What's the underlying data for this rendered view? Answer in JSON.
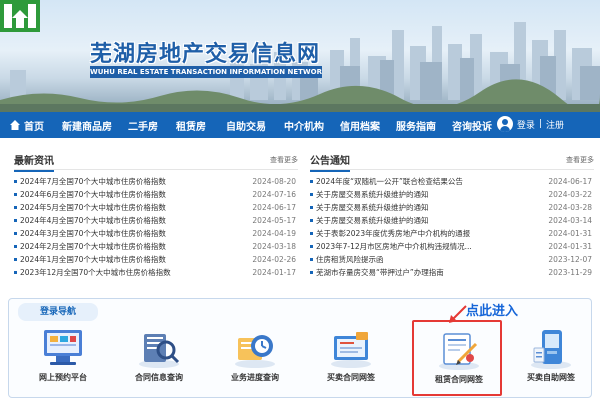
{
  "site": {
    "title": "芜湖房地产交易信息网",
    "subtitle": "WUHU REAL ESTATE TRANSACTION INFORMATION NETWORK"
  },
  "nav": {
    "items": [
      "首页",
      "新建商品房",
      "二手房",
      "租赁房",
      "自助交易",
      "中介机构",
      "信用档案",
      "服务指南",
      "咨询投诉"
    ],
    "login": "登录",
    "register": "注册",
    "separator": "|"
  },
  "news": {
    "title": "最新资讯",
    "more": "查看更多",
    "items": [
      {
        "text": "2024年7月全国70个大中城市住房价格指数",
        "date": "2024-08-20"
      },
      {
        "text": "2024年6月全国70个大中城市住房价格指数",
        "date": "2024-07-16"
      },
      {
        "text": "2024年5月全国70个大中城市住房价格指数",
        "date": "2024-06-17"
      },
      {
        "text": "2024年4月全国70个大中城市住房价格指数",
        "date": "2024-05-17"
      },
      {
        "text": "2024年3月全国70个大中城市住房价格指数",
        "date": "2024-04-19"
      },
      {
        "text": "2024年2月全国70个大中城市住房价格指数",
        "date": "2024-03-18"
      },
      {
        "text": "2024年1月全国70个大中城市住房价格指数",
        "date": "2024-02-26"
      },
      {
        "text": "2023年12月全国70个大中城市住房价格指数",
        "date": "2024-01-17"
      }
    ]
  },
  "notices": {
    "title": "公告通知",
    "more": "查看更多",
    "items": [
      {
        "text": "2024年度“双随机一公开”联合检查结果公告",
        "date": "2024-06-17"
      },
      {
        "text": "关于房屋交易系统升级维护的通知",
        "date": "2024-03-22"
      },
      {
        "text": "关于房屋交易系统升级维护的通知",
        "date": "2024-03-28"
      },
      {
        "text": "关于房屋交易系统升级维护的通知",
        "date": "2024-03-14"
      },
      {
        "text": "关于表彰2023年度优秀房地产中介机构的通报",
        "date": "2024-01-31"
      },
      {
        "text": "2023年7-12月市区房地产中介机构违规情况...",
        "date": "2024-01-31"
      },
      {
        "text": "住房租赁风险提示函",
        "date": "2023-12-07"
      },
      {
        "text": "芜湖市存量房交易“带押过户”办理指南",
        "date": "2023-11-29"
      }
    ]
  },
  "login_nav": {
    "title": "登录导航",
    "annotation": "点此进入",
    "tiles": [
      {
        "label": "网上预约平台",
        "icon": "appointment-icon"
      },
      {
        "label": "合同信息查询",
        "icon": "contract-query-icon"
      },
      {
        "label": "业务进度查询",
        "icon": "progress-query-icon"
      },
      {
        "label": "买卖合同网签",
        "icon": "sale-contract-icon"
      },
      {
        "label": "租赁合同网签",
        "icon": "lease-contract-icon"
      },
      {
        "label": "买卖自助网签",
        "icon": "self-service-icon"
      }
    ]
  },
  "colors": {
    "brand": "#1565b8",
    "highlight": "#e53935",
    "annotation": "#1565d8"
  }
}
